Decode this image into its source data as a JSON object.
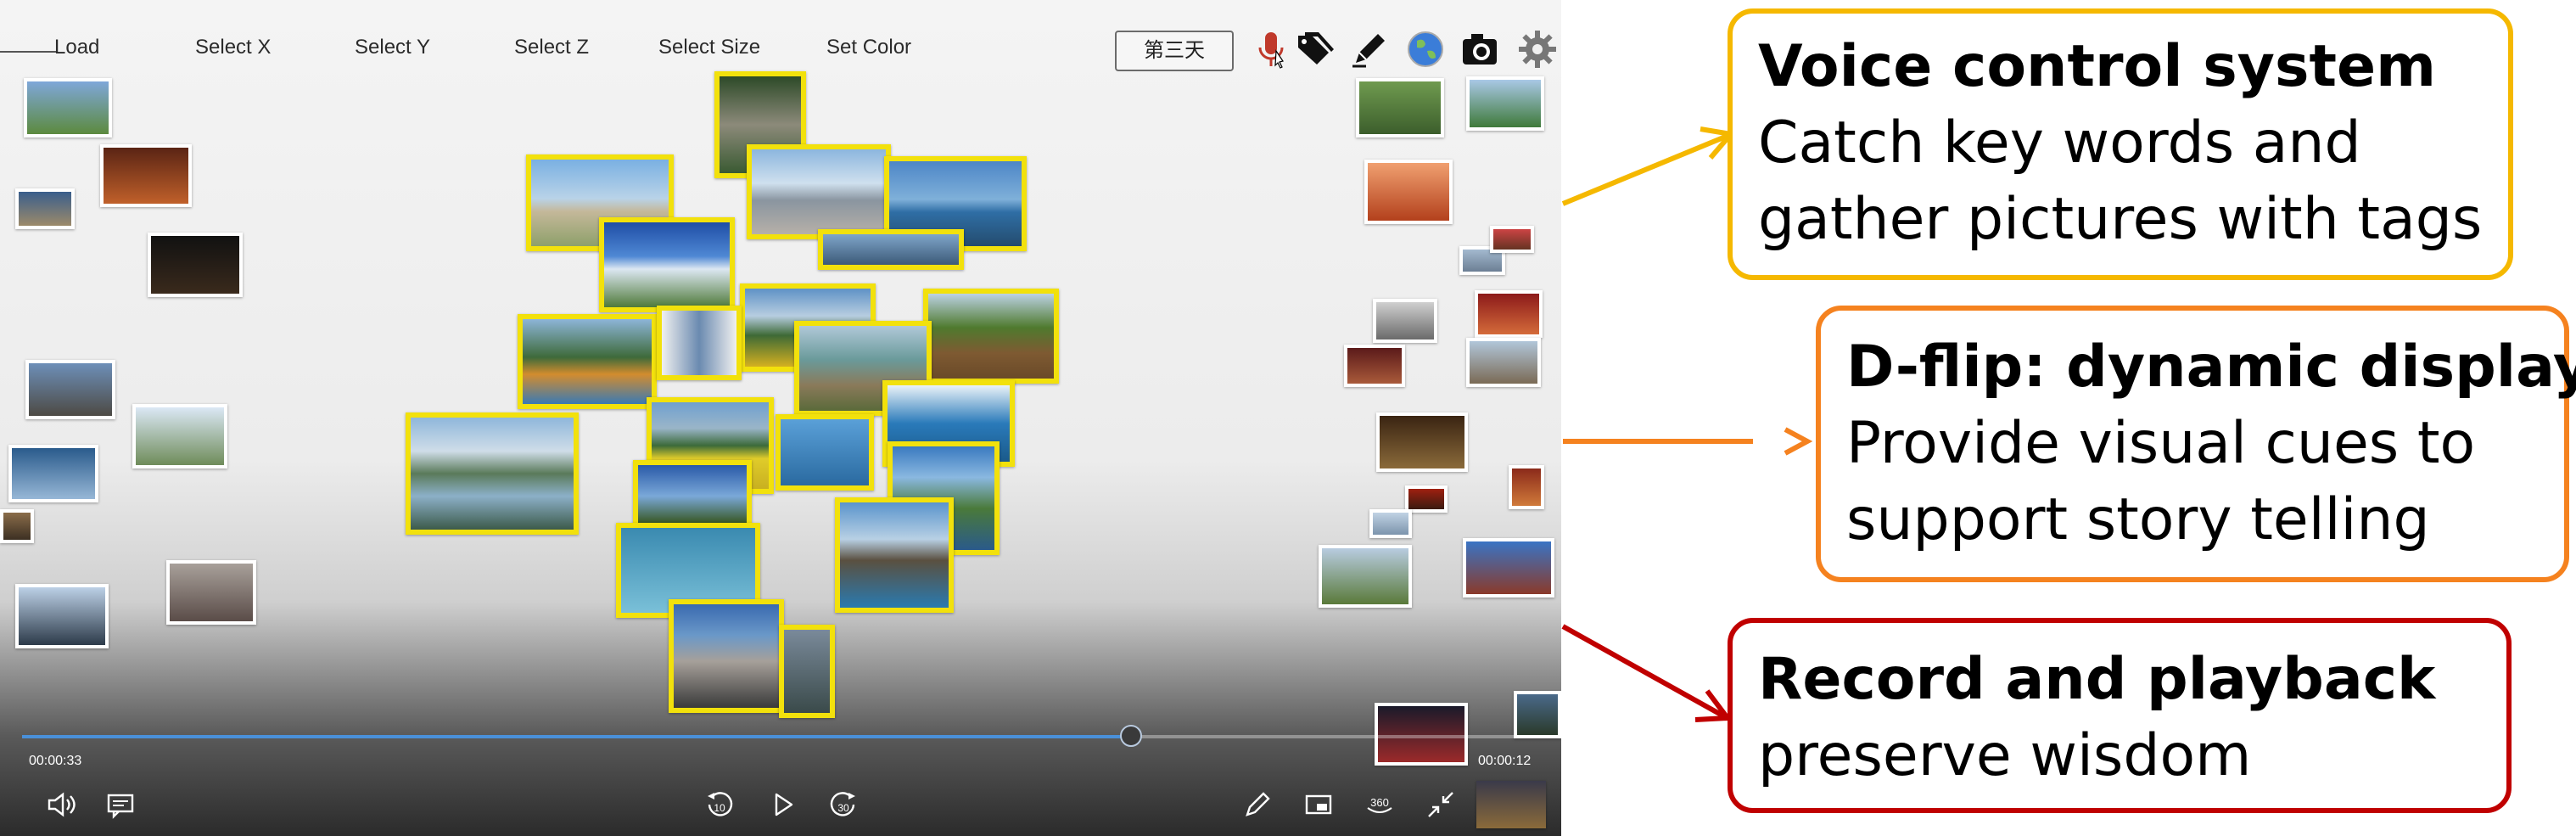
{
  "menu": {
    "items": [
      "Load",
      "Select X",
      "Select Y",
      "Select Z",
      "Select Size",
      "Set Color"
    ],
    "day_button": "第三天"
  },
  "toolbar_icons": [
    "microphone-icon",
    "tag-icon",
    "pencil-icon",
    "globe-icon",
    "camera-icon",
    "gear-icon"
  ],
  "player": {
    "elapsed": "00:00:33",
    "remaining": "00:00:12",
    "progress": 0.73,
    "rewind_label": "10",
    "forward_label": "30",
    "vr_label": "360"
  },
  "callouts": [
    {
      "title": "Voice control system",
      "lines": [
        "Catch key words and",
        "gather pictures with tags"
      ],
      "color": "#f5b800"
    },
    {
      "title": "D-flip: dynamic display",
      "lines": [
        "Provide visual cues to",
        "support story telling"
      ],
      "color": "#f5821f"
    },
    {
      "title": "Record and playback",
      "lines": [
        "preserve wisdom"
      ],
      "color": "#c00000"
    }
  ]
}
